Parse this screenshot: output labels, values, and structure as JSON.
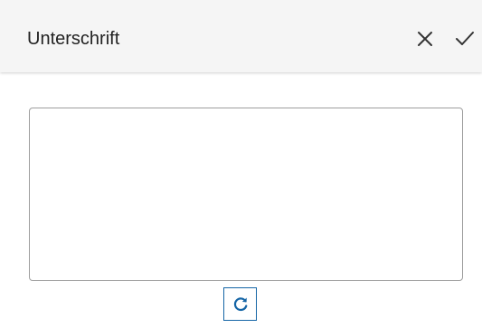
{
  "header": {
    "title": "Unterschrift",
    "close_icon": "close-icon",
    "confirm_icon": "checkmark-icon"
  },
  "signature_pad": {
    "value": ""
  },
  "reset_button": {
    "icon": "refresh-icon"
  },
  "colors": {
    "header_bg": "#f5f5f5",
    "accent": "#1565a6",
    "text": "#222222",
    "border": "#9e9e9e"
  }
}
